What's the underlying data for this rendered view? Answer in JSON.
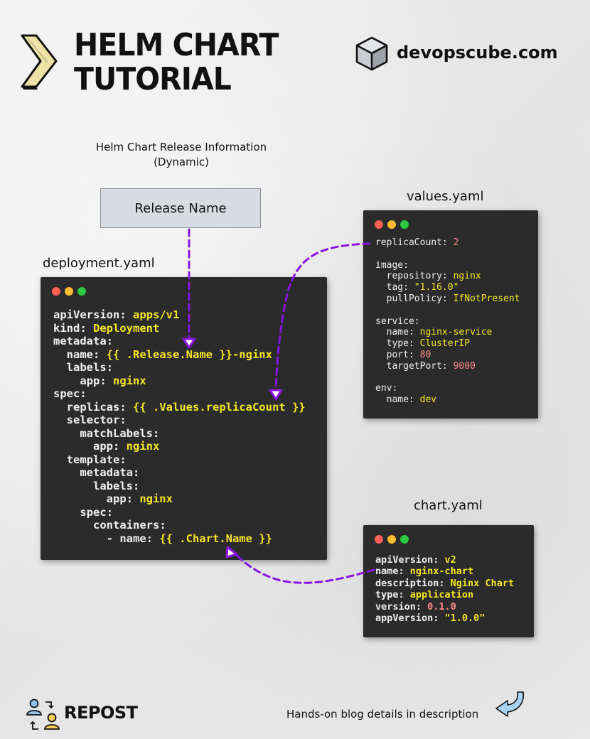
{
  "header": {
    "title_line1": "HELM CHART",
    "title_line2": "TUTORIAL",
    "brand": "devopscube.com"
  },
  "caption": {
    "line1": "Helm Chart Release Information",
    "line2": "(Dynamic)"
  },
  "release_box": "Release Name",
  "files": {
    "deployment": {
      "label": "deployment.yaml",
      "lines": [
        {
          "indent": "",
          "key": "apiVersion:",
          "val": " apps/v1",
          "cls": "v"
        },
        {
          "indent": "",
          "key": "kind:",
          "val": " Deployment",
          "cls": "v"
        },
        {
          "indent": "",
          "key": "metadata:",
          "val": "",
          "cls": "v"
        },
        {
          "indent": "  ",
          "key": "name:",
          "val": " {{ .Release.Name }}-nginx",
          "cls": "v"
        },
        {
          "indent": "  ",
          "key": "labels:",
          "val": "",
          "cls": "v"
        },
        {
          "indent": "    ",
          "key": "app:",
          "val": " nginx",
          "cls": "v"
        },
        {
          "indent": "",
          "key": "spec:",
          "val": "",
          "cls": "v"
        },
        {
          "indent": "  ",
          "key": "replicas:",
          "val": " {{ .Values.replicaCount }}",
          "cls": "v"
        },
        {
          "indent": "  ",
          "key": "selector:",
          "val": "",
          "cls": "v"
        },
        {
          "indent": "    ",
          "key": "matchLabels:",
          "val": "",
          "cls": "v"
        },
        {
          "indent": "      ",
          "key": "app:",
          "val": " nginx",
          "cls": "v"
        },
        {
          "indent": "  ",
          "key": "template:",
          "val": "",
          "cls": "v"
        },
        {
          "indent": "    ",
          "key": "metadata:",
          "val": "",
          "cls": "v"
        },
        {
          "indent": "      ",
          "key": "labels:",
          "val": "",
          "cls": "v"
        },
        {
          "indent": "        ",
          "key": "app:",
          "val": " nginx",
          "cls": "v"
        },
        {
          "indent": "    ",
          "key": "spec:",
          "val": "",
          "cls": "v"
        },
        {
          "indent": "      ",
          "key": "containers:",
          "val": "",
          "cls": "v"
        },
        {
          "indent": "        ",
          "key": "- name:",
          "val": " {{ .Chart.Name }}",
          "cls": "v"
        }
      ]
    },
    "values": {
      "label": "values.yaml",
      "lines": [
        {
          "indent": "",
          "key": "replicaCount:",
          "val": " 2",
          "cls": "n"
        },
        {
          "indent": "",
          "key": "",
          "val": "",
          "cls": "v"
        },
        {
          "indent": "",
          "key": "image:",
          "val": "",
          "cls": "v"
        },
        {
          "indent": "  ",
          "key": "repository:",
          "val": " nginx",
          "cls": "v"
        },
        {
          "indent": "  ",
          "key": "tag:",
          "val": " \"1.16.0\"",
          "cls": "v"
        },
        {
          "indent": "  ",
          "key": "pullPolicy:",
          "val": " IfNotPresent",
          "cls": "v"
        },
        {
          "indent": "",
          "key": "",
          "val": "",
          "cls": "v"
        },
        {
          "indent": "",
          "key": "service:",
          "val": "",
          "cls": "v"
        },
        {
          "indent": "  ",
          "key": "name:",
          "val": " nginx-service",
          "cls": "v"
        },
        {
          "indent": "  ",
          "key": "type:",
          "val": " ClusterIP",
          "cls": "v"
        },
        {
          "indent": "  ",
          "key": "port:",
          "val": " 80",
          "cls": "n"
        },
        {
          "indent": "  ",
          "key": "targetPort:",
          "val": " 9000",
          "cls": "n"
        },
        {
          "indent": "",
          "key": "",
          "val": "",
          "cls": "v"
        },
        {
          "indent": "",
          "key": "env:",
          "val": "",
          "cls": "v"
        },
        {
          "indent": "  ",
          "key": "name:",
          "val": " dev",
          "cls": "v"
        }
      ]
    },
    "chart": {
      "label": "chart.yaml",
      "lines": [
        {
          "indent": "",
          "key": "apiVersion:",
          "val": " v2",
          "cls": "v"
        },
        {
          "indent": "",
          "key": "name:",
          "val": " nginx-chart",
          "cls": "v"
        },
        {
          "indent": "",
          "key": "description:",
          "val": " Nginx Chart",
          "cls": "v"
        },
        {
          "indent": "",
          "key": "type:",
          "val": " application",
          "cls": "v"
        },
        {
          "indent": "",
          "key": "version:",
          "val": " 0.1.0",
          "cls": "n"
        },
        {
          "indent": "",
          "key": "appVersion:",
          "val": " \"1.0.0\"",
          "cls": "v"
        }
      ]
    }
  },
  "footer": {
    "repost": "REPOST",
    "note": "Hands-on blog details in description"
  },
  "colors": {
    "arrow": "#8a14e0",
    "code_bg": "#2b2b2b",
    "code_value": "#f5e625",
    "code_number": "#ff8a8a",
    "chevron": "#efe2a6"
  },
  "icons": [
    "chevron-logo-icon",
    "cube-icon",
    "repost-people-icon",
    "curved-arrow-icon"
  ]
}
